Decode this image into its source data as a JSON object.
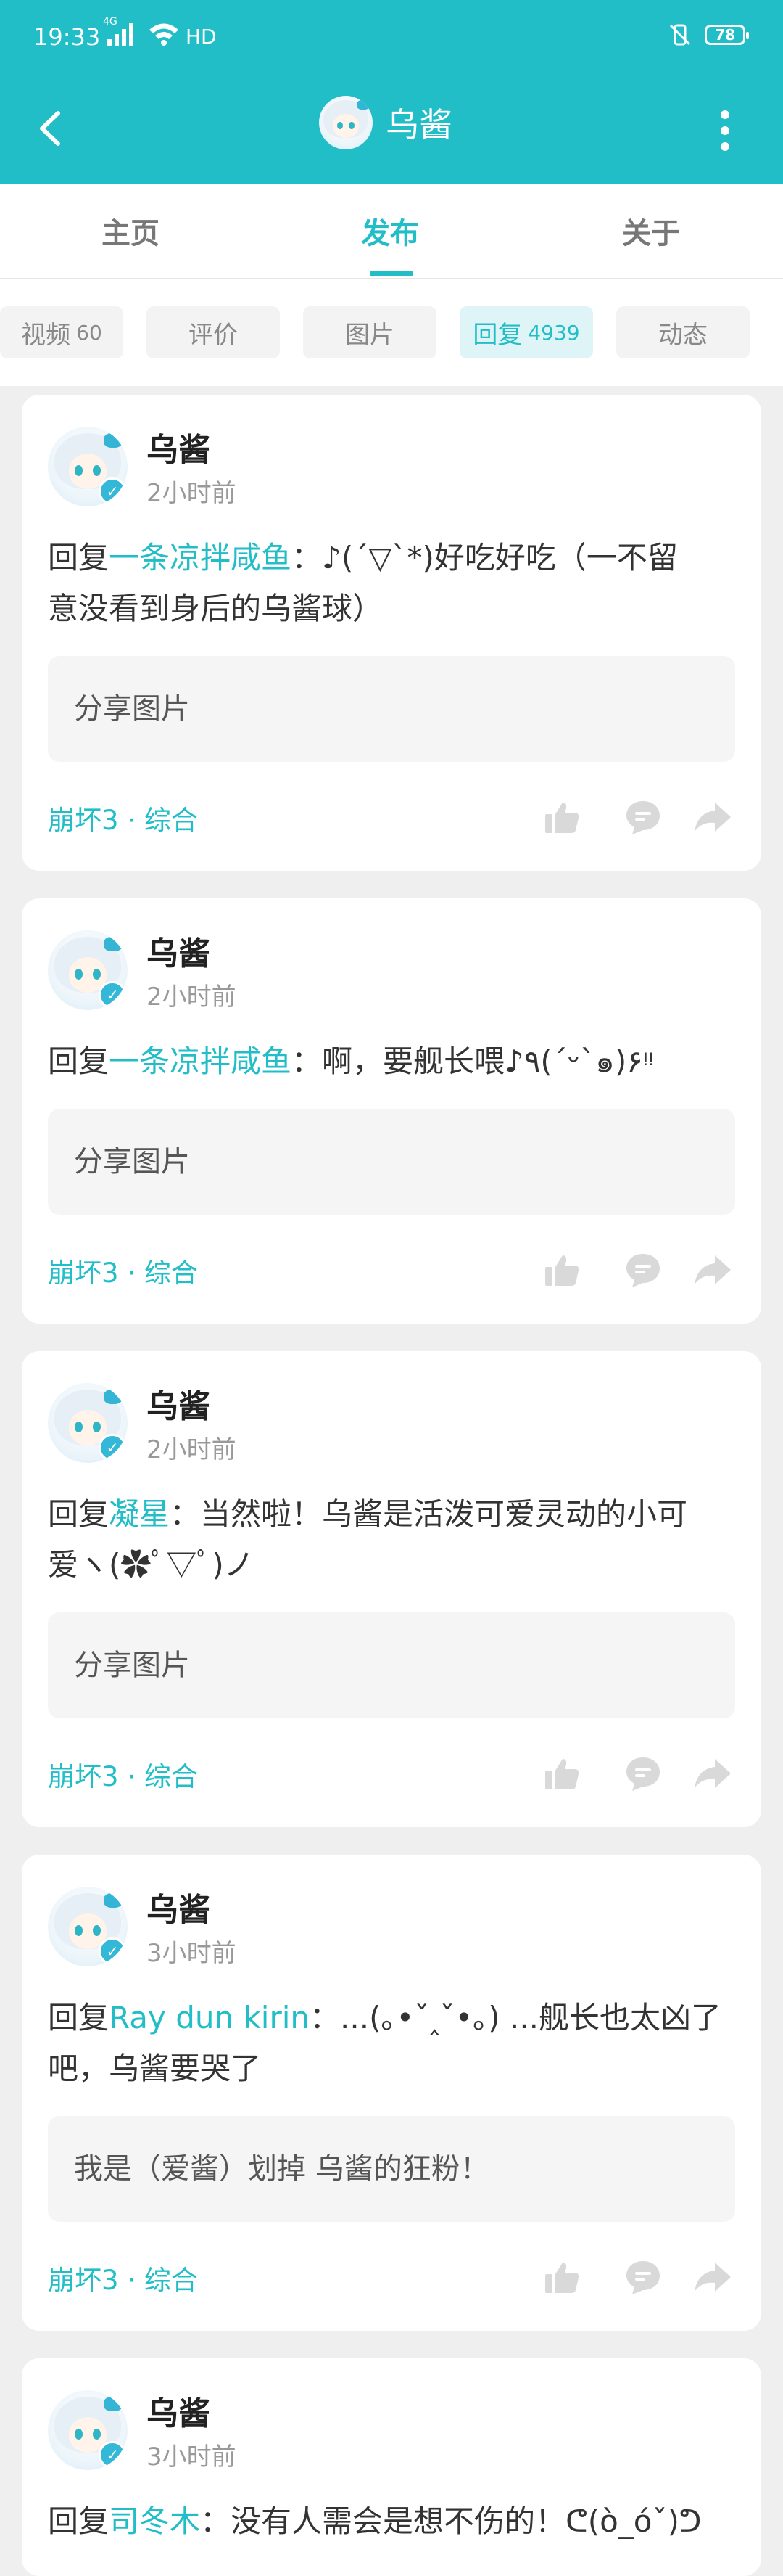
{
  "status_bar": {
    "time": "19:33",
    "network": "4G",
    "hd": "HD",
    "battery": "78"
  },
  "header": {
    "title": "乌酱"
  },
  "tabs": [
    {
      "label": "主页",
      "active": false
    },
    {
      "label": "发布",
      "active": true
    },
    {
      "label": "关于",
      "active": false
    }
  ],
  "filters": [
    {
      "label": "视频",
      "count": "60",
      "active": false
    },
    {
      "label": "评价",
      "count": "",
      "active": false
    },
    {
      "label": "图片",
      "count": "",
      "active": false
    },
    {
      "label": "回复",
      "count": "4939",
      "active": true
    },
    {
      "label": "动态",
      "count": "",
      "active": false
    }
  ],
  "posts": [
    {
      "author": "乌酱",
      "time": "2小时前",
      "reply_prefix": "回复",
      "mention": "一条凉拌咸鱼",
      "text_line1": "：♪(´▽`*)好吃好吃（一不留",
      "text_line2": "意没看到身后的乌酱球）",
      "quote": "分享图片",
      "tag": "崩坏3 · 综合"
    },
    {
      "author": "乌酱",
      "time": "2小时前",
      "reply_prefix": "回复",
      "mention": "一条凉拌咸鱼",
      "text_line1": "：啊，要舰长喂♪٩(´ᵕ`๑)۶ᵎᵎ",
      "text_line2": "",
      "quote": "分享图片",
      "tag": "崩坏3 · 综合"
    },
    {
      "author": "乌酱",
      "time": "2小时前",
      "reply_prefix": "回复",
      "mention": "凝星",
      "text_line1": "：当然啦！乌酱是活泼可爱灵动的小可",
      "text_line2": "爱ヽ(✿ﾟ▽ﾟ)ノ",
      "quote": "分享图片",
      "tag": "崩坏3 · 综合"
    },
    {
      "author": "乌酱",
      "time": "3小时前",
      "reply_prefix": "回复",
      "mention": "Ray dun kirin",
      "text_line1": "：...(｡•ˇ‸ˇ•｡) ...舰长也太凶了",
      "text_line2": "吧，乌酱要哭了",
      "quote": "我是（爱酱）划掉 乌酱的狂粉！",
      "tag": "崩坏3 · 综合"
    },
    {
      "author": "乌酱",
      "time": "3小时前",
      "reply_prefix": "回复",
      "mention": "司冬木",
      "text_line1": "：没有人需会是想不伤的！ᕦ(ò_óˇ)ᕤ",
      "text_line2": "",
      "quote": "",
      "tag": ""
    }
  ],
  "colors": {
    "accent": "#22bec8",
    "background": "#efefef",
    "card": "#ffffff"
  }
}
